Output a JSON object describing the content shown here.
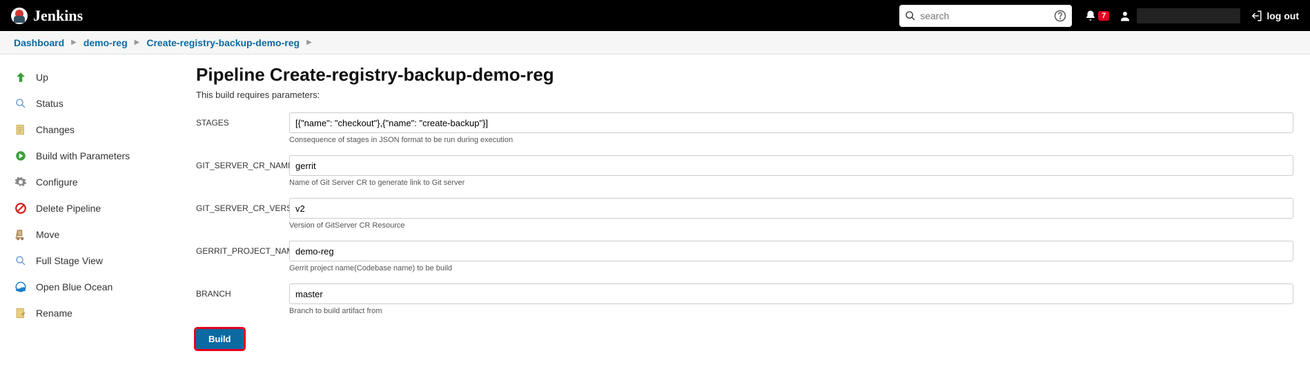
{
  "header": {
    "brand": "Jenkins",
    "search_placeholder": "search",
    "notification_count": "7",
    "logout_label": "log out"
  },
  "breadcrumbs": [
    {
      "label": "Dashboard"
    },
    {
      "label": "demo-reg"
    },
    {
      "label": "Create-registry-backup-demo-reg"
    }
  ],
  "sidebar": [
    {
      "label": "Up",
      "icon": "arrow-up-icon"
    },
    {
      "label": "Status",
      "icon": "magnifier-icon"
    },
    {
      "label": "Changes",
      "icon": "document-icon"
    },
    {
      "label": "Build with Parameters",
      "icon": "play-gear-icon"
    },
    {
      "label": "Configure",
      "icon": "gear-icon"
    },
    {
      "label": "Delete Pipeline",
      "icon": "no-entry-icon"
    },
    {
      "label": "Move",
      "icon": "dolly-icon"
    },
    {
      "label": "Full Stage View",
      "icon": "magnifier-icon"
    },
    {
      "label": "Open Blue Ocean",
      "icon": "blue-ocean-icon"
    },
    {
      "label": "Rename",
      "icon": "rename-icon"
    }
  ],
  "main": {
    "title": "Pipeline Create-registry-backup-demo-reg",
    "subtitle": "This build requires parameters:",
    "params": [
      {
        "name": "STAGES",
        "value": "[{\"name\": \"checkout\"},{\"name\": \"create-backup\"}]",
        "help": "Consequence of stages in JSON format to be run during execution"
      },
      {
        "name": "GIT_SERVER_CR_NAME",
        "value": "gerrit",
        "help": "Name of Git Server CR to generate link to Git server"
      },
      {
        "name": "GIT_SERVER_CR_VERSION",
        "value": "v2",
        "help": "Version of GitServer CR Resource"
      },
      {
        "name": "GERRIT_PROJECT_NAME",
        "value": "demo-reg",
        "help": "Gerrit project name(Codebase name) to be build"
      },
      {
        "name": "BRANCH",
        "value": "master",
        "help": "Branch to build artifact from"
      }
    ],
    "build_label": "Build"
  }
}
